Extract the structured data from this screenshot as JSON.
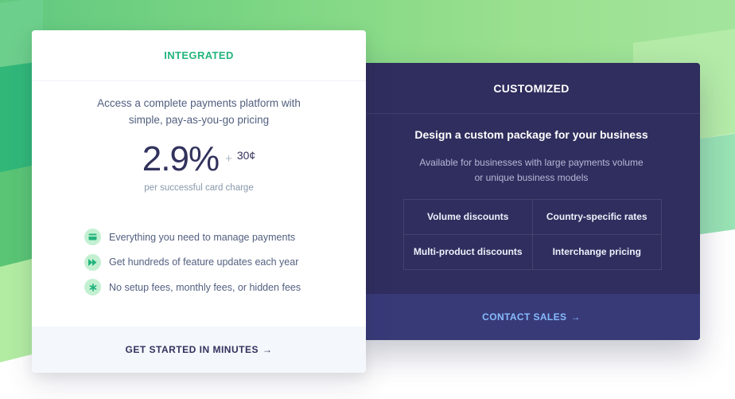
{
  "integrated": {
    "heading": "INTEGRATED",
    "subtitle_line1": "Access a complete payments platform with",
    "subtitle_line2": "simple, pay-as-you-go pricing",
    "price": "2.9%",
    "plus": "+",
    "fixed_fee": "30¢",
    "price_note": "per successful card charge",
    "benefits": [
      {
        "icon": "card-icon",
        "label": "Everything you need to manage payments"
      },
      {
        "icon": "fast-forward-icon",
        "label": "Get hundreds of feature updates each year"
      },
      {
        "icon": "asterisk-icon",
        "label": "No setup fees, monthly fees, or hidden fees"
      }
    ],
    "cta": "GET STARTED IN MINUTES",
    "cta_arrow": "→"
  },
  "customized": {
    "heading": "CUSTOMIZED",
    "title": "Design a custom package for your business",
    "desc_line1": "Available for businesses with large payments volume",
    "desc_line2": "or unique business models",
    "features": [
      "Volume discounts",
      "Country-specific rates",
      "Multi-product discounts",
      "Interchange pricing"
    ],
    "cta": "CONTACT SALES",
    "cta_arrow": "→"
  },
  "colors": {
    "accent_green": "#24b47e",
    "dark_card": "#2f2e5e",
    "dark_footer": "#383a78",
    "link_blue": "#87bbfd"
  }
}
